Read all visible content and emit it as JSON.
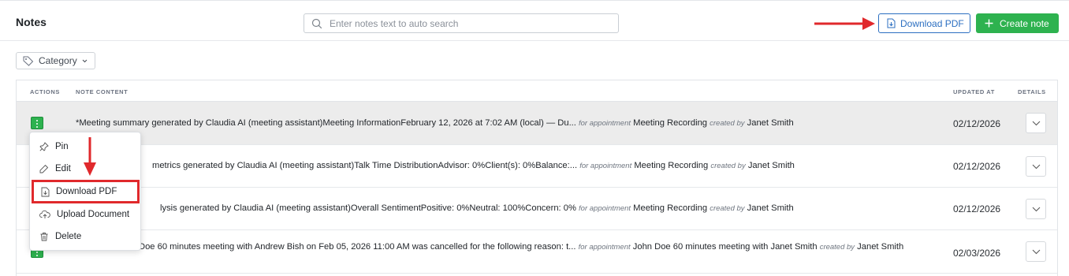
{
  "header": {
    "title": "Notes",
    "search_placeholder": "Enter notes text to auto search",
    "download_label": "Download PDF",
    "create_label": "Create note"
  },
  "filter": {
    "category_label": "Category"
  },
  "table": {
    "columns": {
      "actions": "ACTIONS",
      "content": "NOTE CONTENT",
      "updated": "UPDATED AT",
      "details": "DETAILS"
    },
    "rows": [
      {
        "text": "*Meeting summary generated by Claudia AI (meeting assistant)Meeting InformationFebruary 12, 2026 at 7:02 AM (local) — Du...",
        "for_label": "for appointment",
        "appointment": "Meeting Recording",
        "by_label": "created by",
        "author": "Janet Smith",
        "date": "02/12/2026"
      },
      {
        "text": "metrics generated by Claudia AI (meeting assistant)Talk Time DistributionAdvisor: 0%Client(s): 0%Balance:...",
        "for_label": "for appointment",
        "appointment": "Meeting Recording",
        "by_label": "created by",
        "author": "Janet Smith",
        "date": "02/12/2026"
      },
      {
        "text": "lysis generated by Claudia AI (meeting assistant)Overall SentimentPositive: 0%Neutral: 100%Concern: 0%",
        "for_label": "for appointment",
        "appointment": "Meeting Recording",
        "by_label": "created by",
        "author": "Janet Smith",
        "date": "02/12/2026"
      },
      {
        "text": "Doe 60 minutes meeting with Andrew Bish on Feb 05, 2026 11:00 AM was cancelled for the following reason: t...",
        "for_label": "for appointment",
        "appointment": "John Doe 60 minutes meeting with Janet Smith",
        "by_label": "created by",
        "author": "Janet Smith",
        "date": "02/03/2026"
      }
    ]
  },
  "menu": {
    "items": [
      "Pin",
      "Edit",
      "Download PDF",
      "Upload Document",
      "Delete"
    ]
  },
  "colors": {
    "accent_blue": "#2c6fc1",
    "accent_green": "#2eb24f",
    "annotation_red": "#e0292c"
  }
}
